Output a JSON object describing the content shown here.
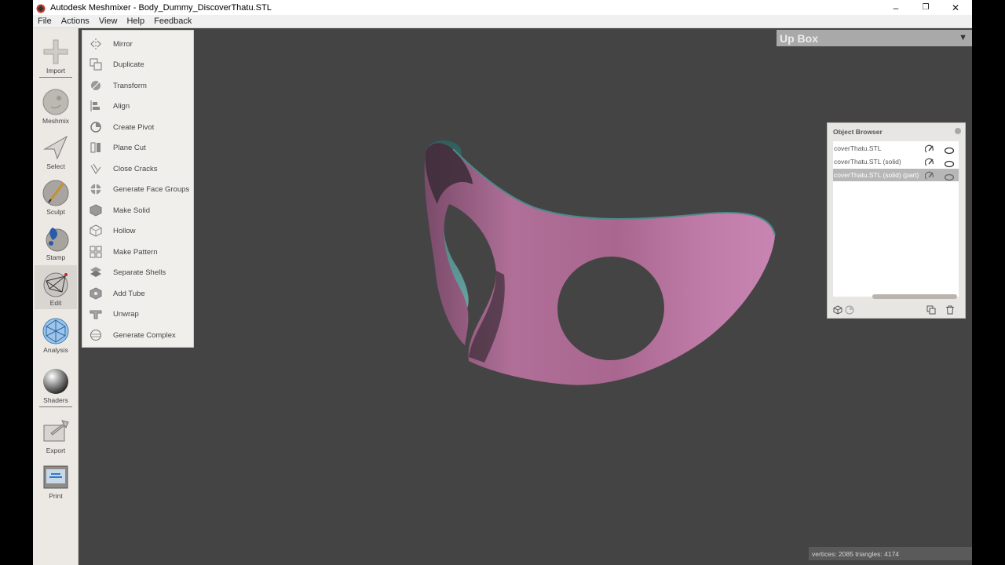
{
  "window": {
    "title": "Autodesk Meshmixer - Body_Dummy_DiscoverThatu.STL",
    "controls": {
      "minimize": "–",
      "maximize": "❐",
      "close": "✕"
    }
  },
  "menubar": {
    "items": [
      "File",
      "Actions",
      "View",
      "Help",
      "Feedback"
    ]
  },
  "toolbar": {
    "tools": [
      {
        "label": "Import",
        "icon": "import-icon"
      },
      {
        "label": "Meshmix",
        "icon": "meshmix-icon"
      },
      {
        "label": "Select",
        "icon": "select-icon"
      },
      {
        "label": "Sculpt",
        "icon": "sculpt-icon"
      },
      {
        "label": "Stamp",
        "icon": "stamp-icon"
      },
      {
        "label": "Edit",
        "icon": "edit-icon",
        "active": true
      },
      {
        "label": "Analysis",
        "icon": "analysis-icon"
      },
      {
        "label": "Shaders",
        "icon": "shaders-icon"
      },
      {
        "label": "Export",
        "icon": "export-icon"
      },
      {
        "label": "Print",
        "icon": "print-icon"
      }
    ]
  },
  "edit_menu": {
    "items": [
      {
        "label": "Mirror",
        "icon": "mirror-icon"
      },
      {
        "label": "Duplicate",
        "icon": "duplicate-icon"
      },
      {
        "label": "Transform",
        "icon": "transform-icon"
      },
      {
        "label": "Align",
        "icon": "align-icon"
      },
      {
        "label": "Create Pivot",
        "icon": "pivot-icon"
      },
      {
        "label": "Plane Cut",
        "icon": "plane-cut-icon"
      },
      {
        "label": "Close Cracks",
        "icon": "close-cracks-icon"
      },
      {
        "label": "Generate Face Groups",
        "icon": "face-groups-icon"
      },
      {
        "label": "Make Solid",
        "icon": "make-solid-icon"
      },
      {
        "label": "Hollow",
        "icon": "hollow-icon"
      },
      {
        "label": "Make Pattern",
        "icon": "make-pattern-icon"
      },
      {
        "label": "Separate Shells",
        "icon": "separate-shells-icon"
      },
      {
        "label": "Add Tube",
        "icon": "add-tube-icon"
      },
      {
        "label": "Unwrap",
        "icon": "unwrap-icon"
      },
      {
        "label": "Generate Complex",
        "icon": "generate-complex-icon"
      }
    ]
  },
  "up_box": {
    "title": "Up Box",
    "arrow": "▼"
  },
  "object_browser": {
    "title": "Object Browser",
    "objects": [
      {
        "name": "coverThatu.STL",
        "selected": false
      },
      {
        "name": "coverThatu.STL (solid)",
        "selected": false
      },
      {
        "name": "coverThatu.STL (solid) (part)",
        "selected": true
      }
    ]
  },
  "status": {
    "text": "vertices: 2085 triangles: 4174"
  },
  "colors": {
    "viewport": "#444444",
    "model_pink": "#b06f98",
    "model_inner": "#4f8d8a",
    "panel": "#ece9e5"
  }
}
